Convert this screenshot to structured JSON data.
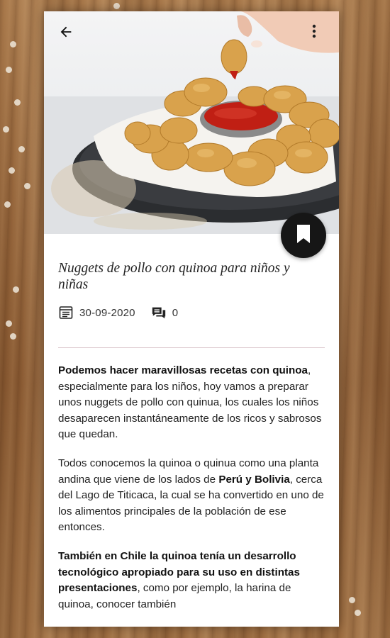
{
  "header": {
    "back_icon": "arrow-back-icon",
    "menu_icon": "more-vert-icon"
  },
  "article": {
    "title": "Nuggets de pollo con quinoa para niños y niñas",
    "date": "30-09-2020",
    "comment_count": "0",
    "paragraphs": [
      [
        {
          "text": "Podemos hacer maravillosas recetas con quinoa",
          "bold": true
        },
        {
          "text": ", especialmente para los niños, hoy vamos a preparar unos nuggets de pollo con quinua, los cuales los niños desaparecen instantáneamente de los ricos y sabrosos que quedan.",
          "bold": false
        }
      ],
      [
        {
          "text": "Todos conocemos la quinoa o quinua como una planta andina que viene de los lados de ",
          "bold": false
        },
        {
          "text": "Perú y Bolivia",
          "bold": true
        },
        {
          "text": ", cerca del Lago de Titicaca, la cual se ha convertido en uno de los alimentos principales de la población de ese entonces.",
          "bold": false
        }
      ],
      [
        {
          "text": "También en Chile la quinoa tenía un desarrollo tecnológico apropiado para su uso en distintas presentaciones",
          "bold": true
        },
        {
          "text": ", como por ejemplo, la harina de quinoa, conocer también",
          "bold": false
        }
      ]
    ]
  },
  "icons": {
    "bookmark": "bookmark-icon",
    "date": "calendar-doc-icon",
    "comments": "comments-icon"
  },
  "colors": {
    "fab": "#161616",
    "divider": "#dcc6cc",
    "text": "#222222"
  }
}
